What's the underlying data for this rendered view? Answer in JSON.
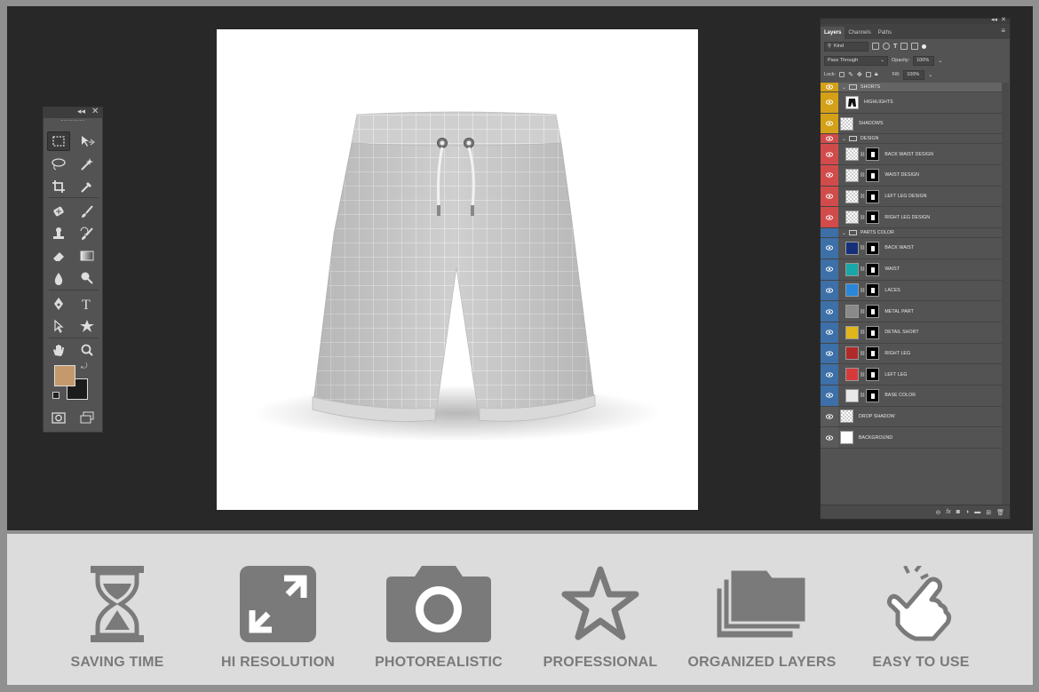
{
  "toolbox": {
    "collapse_icon": "double-chevron-left-icon",
    "close_icon": "close-icon",
    "foreground_color": "#c49a6c",
    "background_color": "#1c1c1c",
    "tools": [
      "rectangular-marquee-icon",
      "move-icon",
      "lasso-icon",
      "magic-wand-icon",
      "crop-icon",
      "eyedropper-icon",
      "healing-brush-icon",
      "brush-icon",
      "clone-stamp-icon",
      "history-brush-icon",
      "eraser-icon",
      "gradient-icon",
      "blur-icon",
      "dodge-icon",
      "pen-icon",
      "type-icon",
      "path-selection-icon",
      "shape-icon",
      "hand-icon",
      "zoom-icon"
    ]
  },
  "layers_panel": {
    "tabs": [
      "Layers",
      "Channels",
      "Paths"
    ],
    "filter_label": "Kind",
    "blend_mode": "Pass Through",
    "opacity_label": "Opacity:",
    "opacity_value": "100%",
    "lock_label": "Lock:",
    "fill_label": "Fill:",
    "fill_value": "100%",
    "layers": [
      {
        "name": "SHORTS",
        "kind": "group",
        "color": "#d4a017",
        "visible": true
      },
      {
        "name": "HIGHLIGHTS",
        "kind": "layer",
        "color": "#d4a017",
        "visible": true,
        "thumb": "shorts-black"
      },
      {
        "name": "SHADOWS",
        "kind": "layer",
        "color": "#d4a017",
        "visible": true,
        "thumb": "checker"
      },
      {
        "name": "DESIGN",
        "kind": "group",
        "color": "#d24b4b",
        "visible": true
      },
      {
        "name": "BACK WAIST DESIGN",
        "kind": "smart",
        "color": "#d24b4b",
        "visible": true
      },
      {
        "name": "WAIST DESIGN",
        "kind": "smart",
        "color": "#d24b4b",
        "visible": true
      },
      {
        "name": "LEFT LEG DESIGN",
        "kind": "smart",
        "color": "#d24b4b",
        "visible": true
      },
      {
        "name": "RIGHT LEG DESIGN",
        "kind": "smart",
        "color": "#d24b4b",
        "visible": true
      },
      {
        "name": "PARTS COLOR",
        "kind": "group",
        "color": "#3d6fa8",
        "visible": false
      },
      {
        "name": "BACK WAIST",
        "kind": "fill",
        "color": "#3d6fa8",
        "visible": true,
        "swatch": "#152f78"
      },
      {
        "name": "WAIST",
        "kind": "fill",
        "color": "#3d6fa8",
        "visible": true,
        "swatch": "#1aa7a7"
      },
      {
        "name": "LACES",
        "kind": "fill",
        "color": "#3d6fa8",
        "visible": true,
        "swatch": "#2a86d8"
      },
      {
        "name": "METAL PART",
        "kind": "fill",
        "color": "#3d6fa8",
        "visible": true,
        "swatch": "#8a8a8a"
      },
      {
        "name": "DETAIL SHORT",
        "kind": "fill",
        "color": "#3d6fa8",
        "visible": true,
        "swatch": "#e0b61a"
      },
      {
        "name": "RIGHT LEG",
        "kind": "fill",
        "color": "#3d6fa8",
        "visible": true,
        "swatch": "#b02a2a"
      },
      {
        "name": "LEFT LEG",
        "kind": "fill",
        "color": "#3d6fa8",
        "visible": true,
        "swatch": "#d63b3b"
      },
      {
        "name": "BASE COLOR",
        "kind": "fill",
        "color": "#3d6fa8",
        "visible": true,
        "swatch": "#e8e8e8"
      },
      {
        "name": "DROP SHADOW",
        "kind": "layer",
        "color": "#5a5a5a",
        "visible": true,
        "thumb": "checker"
      },
      {
        "name": "BACKGROUND",
        "kind": "layer",
        "color": "#5a5a5a",
        "visible": true,
        "thumb": "white"
      }
    ],
    "footer_icons": [
      "link-icon",
      "fx-icon",
      "mask-icon",
      "adjustment-icon",
      "folder-icon",
      "new-layer-icon",
      "trash-icon"
    ]
  },
  "features": [
    {
      "label": "SAVING TIME",
      "icon": "hourglass-icon"
    },
    {
      "label": "HI RESOLUTION",
      "icon": "expand-arrows-icon"
    },
    {
      "label": "PHOTOREALISTIC",
      "icon": "camera-icon"
    },
    {
      "label": "PROFESSIONAL",
      "icon": "star-icon"
    },
    {
      "label": "ORGANIZED LAYERS",
      "icon": "stacked-folders-icon"
    },
    {
      "label": "EASY TO USE",
      "icon": "hand-tap-icon"
    }
  ],
  "colors": {
    "workspace": "#282828",
    "feature_gray": "#7a7a7a",
    "feature_band": "#dcdcdc"
  }
}
